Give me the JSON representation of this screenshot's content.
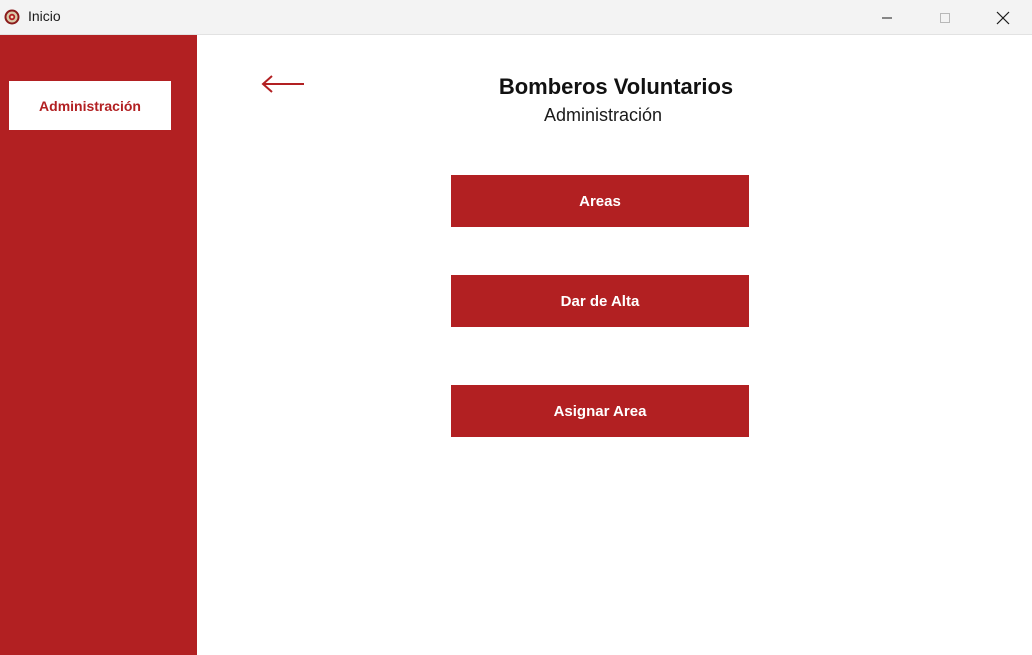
{
  "window": {
    "title": "Inicio",
    "app_icon": "firefighter-emblem-icon",
    "controls": {
      "minimize_icon": "minimize-icon",
      "maximize_icon": "maximize-icon",
      "close_icon": "close-icon"
    }
  },
  "sidebar": {
    "items": [
      {
        "label": "Administración",
        "active": true
      }
    ]
  },
  "main": {
    "back_icon": "back-arrow-icon",
    "title": "Bomberos Voluntarios",
    "subtitle": "Administración",
    "buttons": [
      {
        "label": "Areas"
      },
      {
        "label": "Dar de Alta"
      },
      {
        "label": "Asignar Area"
      }
    ]
  },
  "colors": {
    "accent": "#b22022",
    "background": "#ffffff",
    "titlebar": "#f3f3f3"
  }
}
